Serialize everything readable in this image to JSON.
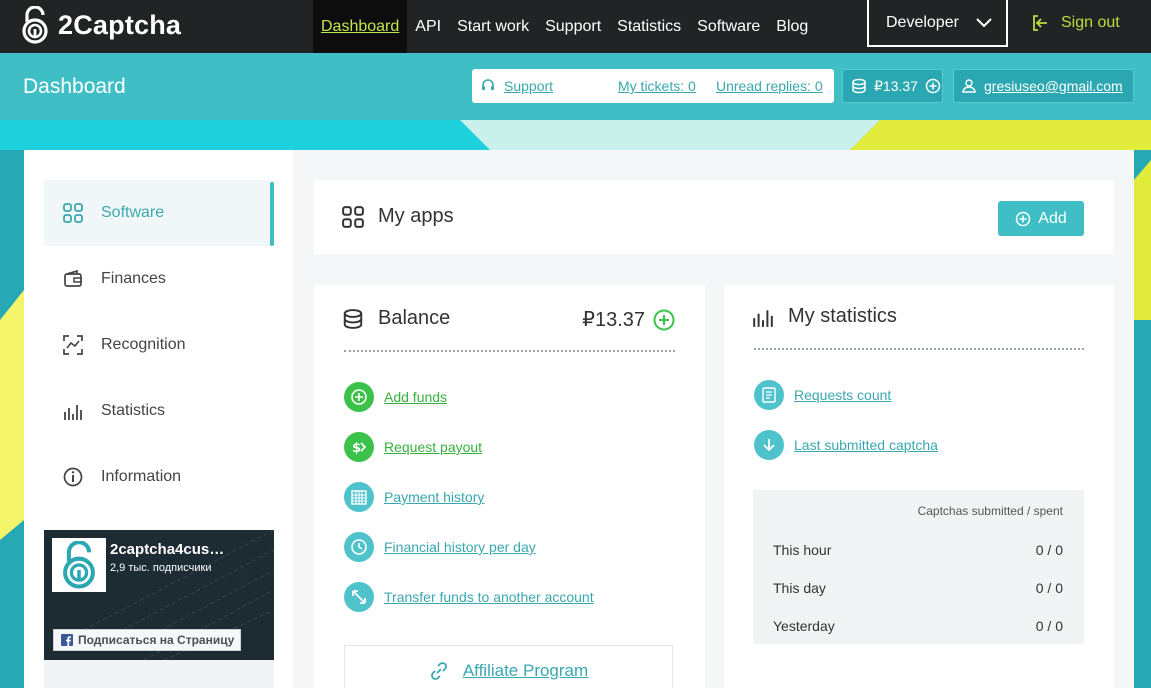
{
  "brand": {
    "name": "2Captcha"
  },
  "nav": {
    "items": [
      {
        "label": "Dashboard",
        "active": true
      },
      {
        "label": "API"
      },
      {
        "label": "Start work"
      },
      {
        "label": "Support"
      },
      {
        "label": "Statistics"
      },
      {
        "label": "Software"
      },
      {
        "label": "Blog"
      }
    ],
    "dropdown_label": "Developer",
    "signout_label": "Sign out"
  },
  "header": {
    "title": "Dashboard",
    "support_label": "Support",
    "tickets_label": "My tickets: 0",
    "unread_label": "Unread replies: 0",
    "balance": "₽13.37",
    "email": "gresiuseo@gmail.com"
  },
  "sidebar": {
    "items": [
      {
        "label": "Software",
        "icon": "grid-icon",
        "active": true
      },
      {
        "label": "Finances",
        "icon": "wallet-icon"
      },
      {
        "label": "Recognition",
        "icon": "recognition-icon"
      },
      {
        "label": "Statistics",
        "icon": "bar-chart-icon"
      },
      {
        "label": "Information",
        "icon": "info-icon"
      }
    ],
    "facebook": {
      "page_name": "2captcha4cus…",
      "followers": "2,9 тыс. подписчики",
      "follow_button": "Подписаться на Страницу"
    }
  },
  "apps": {
    "title": "My apps",
    "add_label": "Add"
  },
  "balance": {
    "title": "Balance",
    "amount": "₽13.37",
    "actions": [
      {
        "label": "Add funds",
        "icon": "plus-circle-icon"
      },
      {
        "label": "Request payout",
        "icon": "payout-icon"
      },
      {
        "label": "Payment history",
        "icon": "calendar-icon"
      },
      {
        "label": "Financial history per day",
        "icon": "clock-history-icon"
      },
      {
        "label": "Transfer funds to another account",
        "icon": "transfer-icon"
      }
    ],
    "affiliate_label": "Affiliate Program"
  },
  "stats": {
    "title": "My statistics",
    "links": [
      {
        "label": "Requests count",
        "icon": "requests-icon"
      },
      {
        "label": "Last submitted captcha",
        "icon": "download-icon"
      }
    ],
    "table_header": "Captchas submitted / spent",
    "rows": [
      {
        "label": "This hour",
        "value": "0 / 0"
      },
      {
        "label": "This day",
        "value": "0 / 0"
      },
      {
        "label": "Yesterday",
        "value": "0 / 0"
      }
    ]
  },
  "colors": {
    "teal": "#3fbec6",
    "green": "#3cc24a",
    "lime": "#c3e64a",
    "dark": "#222324"
  }
}
